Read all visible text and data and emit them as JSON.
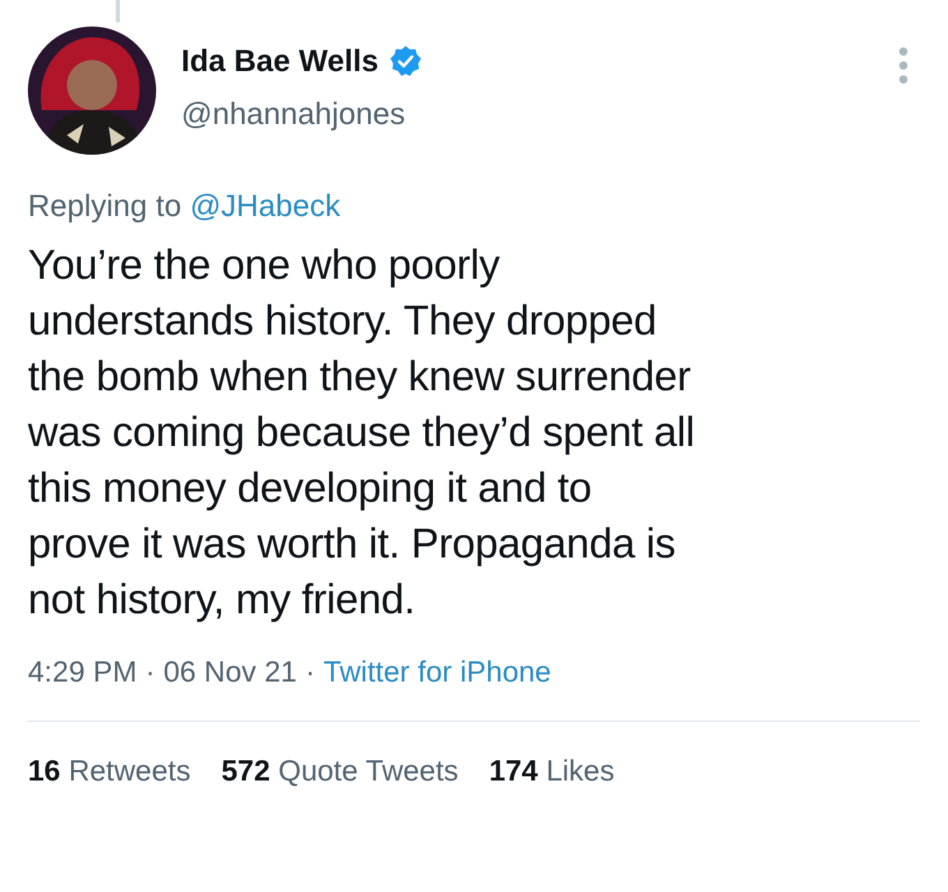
{
  "author": {
    "name": "Ida Bae Wells",
    "verified": true,
    "handle": "@nhannahjones"
  },
  "reply": {
    "prefix": "Replying to",
    "target": "@JHabeck"
  },
  "body": "You’re the one who poorly understands history. They dropped the bomb when they knew surrender was coming because they’d spent all this money developing it and to prove it was worth it. Propaganda is not history, my friend.",
  "meta": {
    "time": "4:29 PM",
    "separator": "·",
    "date": "06 Nov 21",
    "separator_2": "·",
    "source": "Twitter for iPhone"
  },
  "stats": [
    {
      "text": "**16** Retweets"
    },
    {
      "text": "**572** Quote Tweets"
    },
    {
      "text": "**174** Likes"
    }
  ]
}
